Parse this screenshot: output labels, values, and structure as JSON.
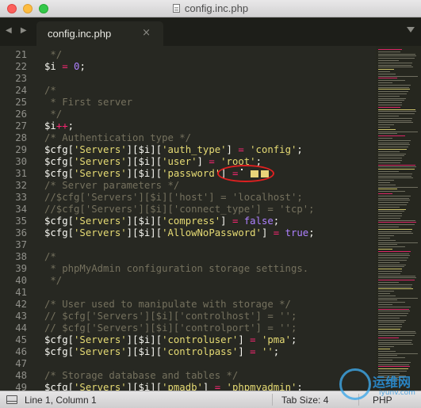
{
  "window": {
    "title": "config.inc.php"
  },
  "tabs": [
    {
      "label": "config.inc.php",
      "close": "×"
    }
  ],
  "nav": {
    "arrows": "◀ ▶"
  },
  "editor": {
    "lines": [
      {
        "n": "21",
        "segs": [
          {
            "t": "c",
            "v": " */"
          }
        ]
      },
      {
        "n": "22",
        "segs": [
          {
            "t": "p",
            "v": "$i "
          },
          {
            "t": "k",
            "v": "="
          },
          {
            "t": "p",
            "v": " "
          },
          {
            "t": "n",
            "v": "0"
          },
          {
            "t": "p",
            "v": ";"
          }
        ]
      },
      {
        "n": "23",
        "segs": []
      },
      {
        "n": "24",
        "segs": [
          {
            "t": "c",
            "v": "/*"
          }
        ]
      },
      {
        "n": "25",
        "segs": [
          {
            "t": "c",
            "v": " * First server"
          }
        ]
      },
      {
        "n": "26",
        "segs": [
          {
            "t": "c",
            "v": " */"
          }
        ]
      },
      {
        "n": "27",
        "segs": [
          {
            "t": "p",
            "v": "$i"
          },
          {
            "t": "k",
            "v": "++"
          },
          {
            "t": "p",
            "v": ";"
          }
        ]
      },
      {
        "n": "28",
        "segs": [
          {
            "t": "c",
            "v": "/* Authentication type */"
          }
        ]
      },
      {
        "n": "29",
        "segs": [
          {
            "t": "p",
            "v": "$cfg["
          },
          {
            "t": "s",
            "v": "'Servers'"
          },
          {
            "t": "p",
            "v": "][$i]["
          },
          {
            "t": "s",
            "v": "'auth_type'"
          },
          {
            "t": "p",
            "v": "] "
          },
          {
            "t": "k",
            "v": "="
          },
          {
            "t": "p",
            "v": " "
          },
          {
            "t": "s",
            "v": "'config'"
          },
          {
            "t": "p",
            "v": ";"
          }
        ]
      },
      {
        "n": "30",
        "segs": [
          {
            "t": "p",
            "v": "$cfg["
          },
          {
            "t": "s",
            "v": "'Servers'"
          },
          {
            "t": "p",
            "v": "][$i]["
          },
          {
            "t": "s",
            "v": "'user'"
          },
          {
            "t": "p",
            "v": "] "
          },
          {
            "t": "k",
            "v": "="
          },
          {
            "t": "p",
            "v": " "
          },
          {
            "t": "s",
            "v": "'root'"
          },
          {
            "t": "p",
            "v": ";"
          }
        ]
      },
      {
        "n": "31",
        "segs": [
          {
            "t": "p",
            "v": "$cfg["
          },
          {
            "t": "s",
            "v": "'Servers'"
          },
          {
            "t": "p",
            "v": "][$i]["
          },
          {
            "t": "s",
            "v": "'password'"
          },
          {
            "t": "p",
            "v": "] "
          },
          {
            "t": "k",
            "v": "="
          },
          {
            "t": "mask",
            "v": ""
          }
        ]
      },
      {
        "n": "32",
        "segs": [
          {
            "t": "c",
            "v": "/* Server parameters */"
          }
        ]
      },
      {
        "n": "33",
        "segs": [
          {
            "t": "c",
            "v": "//$cfg['Servers'][$i]['host'] = 'localhost';"
          }
        ]
      },
      {
        "n": "34",
        "segs": [
          {
            "t": "c",
            "v": "//$cfg['Servers'][$i]['connect_type'] = 'tcp';"
          }
        ]
      },
      {
        "n": "35",
        "segs": [
          {
            "t": "p",
            "v": "$cfg["
          },
          {
            "t": "s",
            "v": "'Servers'"
          },
          {
            "t": "p",
            "v": "][$i]["
          },
          {
            "t": "s",
            "v": "'compress'"
          },
          {
            "t": "p",
            "v": "] "
          },
          {
            "t": "k",
            "v": "="
          },
          {
            "t": "p",
            "v": " "
          },
          {
            "t": "n",
            "v": "false"
          },
          {
            "t": "p",
            "v": ";"
          }
        ]
      },
      {
        "n": "36",
        "segs": [
          {
            "t": "p",
            "v": "$cfg["
          },
          {
            "t": "s",
            "v": "'Servers'"
          },
          {
            "t": "p",
            "v": "][$i]["
          },
          {
            "t": "s",
            "v": "'AllowNoPassword'"
          },
          {
            "t": "p",
            "v": "] "
          },
          {
            "t": "k",
            "v": "="
          },
          {
            "t": "p",
            "v": " "
          },
          {
            "t": "n",
            "v": "true"
          },
          {
            "t": "p",
            "v": ";"
          }
        ]
      },
      {
        "n": "37",
        "segs": []
      },
      {
        "n": "38",
        "segs": [
          {
            "t": "c",
            "v": "/*"
          }
        ]
      },
      {
        "n": "39",
        "segs": [
          {
            "t": "c",
            "v": " * phpMyAdmin configuration storage settings."
          }
        ]
      },
      {
        "n": "40",
        "segs": [
          {
            "t": "c",
            "v": " */"
          }
        ]
      },
      {
        "n": "41",
        "segs": []
      },
      {
        "n": "42",
        "segs": [
          {
            "t": "c",
            "v": "/* User used to manipulate with storage */"
          }
        ]
      },
      {
        "n": "43",
        "segs": [
          {
            "t": "c",
            "v": "// $cfg['Servers'][$i]['controlhost'] = '';"
          }
        ]
      },
      {
        "n": "44",
        "segs": [
          {
            "t": "c",
            "v": "// $cfg['Servers'][$i]['controlport'] = '';"
          }
        ]
      },
      {
        "n": "45",
        "segs": [
          {
            "t": "p",
            "v": "$cfg["
          },
          {
            "t": "s",
            "v": "'Servers'"
          },
          {
            "t": "p",
            "v": "][$i]["
          },
          {
            "t": "s",
            "v": "'controluser'"
          },
          {
            "t": "p",
            "v": "] "
          },
          {
            "t": "k",
            "v": "="
          },
          {
            "t": "p",
            "v": " "
          },
          {
            "t": "s",
            "v": "'pma'"
          },
          {
            "t": "p",
            "v": ";"
          }
        ]
      },
      {
        "n": "46",
        "segs": [
          {
            "t": "p",
            "v": "$cfg["
          },
          {
            "t": "s",
            "v": "'Servers'"
          },
          {
            "t": "p",
            "v": "][$i]["
          },
          {
            "t": "s",
            "v": "'controlpass'"
          },
          {
            "t": "p",
            "v": "] "
          },
          {
            "t": "k",
            "v": "="
          },
          {
            "t": "p",
            "v": " "
          },
          {
            "t": "s",
            "v": "''"
          },
          {
            "t": "p",
            "v": ";"
          }
        ]
      },
      {
        "n": "47",
        "segs": []
      },
      {
        "n": "48",
        "segs": [
          {
            "t": "c",
            "v": "/* Storage database and tables */"
          }
        ]
      },
      {
        "n": "49",
        "segs": [
          {
            "t": "p",
            "v": "$cfg["
          },
          {
            "t": "s",
            "v": "'Servers'"
          },
          {
            "t": "p",
            "v": "][$i]["
          },
          {
            "t": "s",
            "v": "'pmadb'"
          },
          {
            "t": "p",
            "v": "] "
          },
          {
            "t": "k",
            "v": "="
          },
          {
            "t": "p",
            "v": " "
          },
          {
            "t": "s",
            "v": "'phpmyadmin'"
          },
          {
            "t": "p",
            "v": ";"
          }
        ]
      }
    ]
  },
  "statusbar": {
    "position": "Line 1, Column 1",
    "tab_size": "Tab Size: 4",
    "syntax": "PHP"
  },
  "watermark": {
    "text": "运维网",
    "sub": "iyunv.com"
  },
  "colors": {
    "background": "#272822",
    "comment": "#75715e",
    "string": "#e6db74",
    "keyword": "#f92672",
    "constant": "#ae81ff",
    "annotation": "#e02020"
  }
}
